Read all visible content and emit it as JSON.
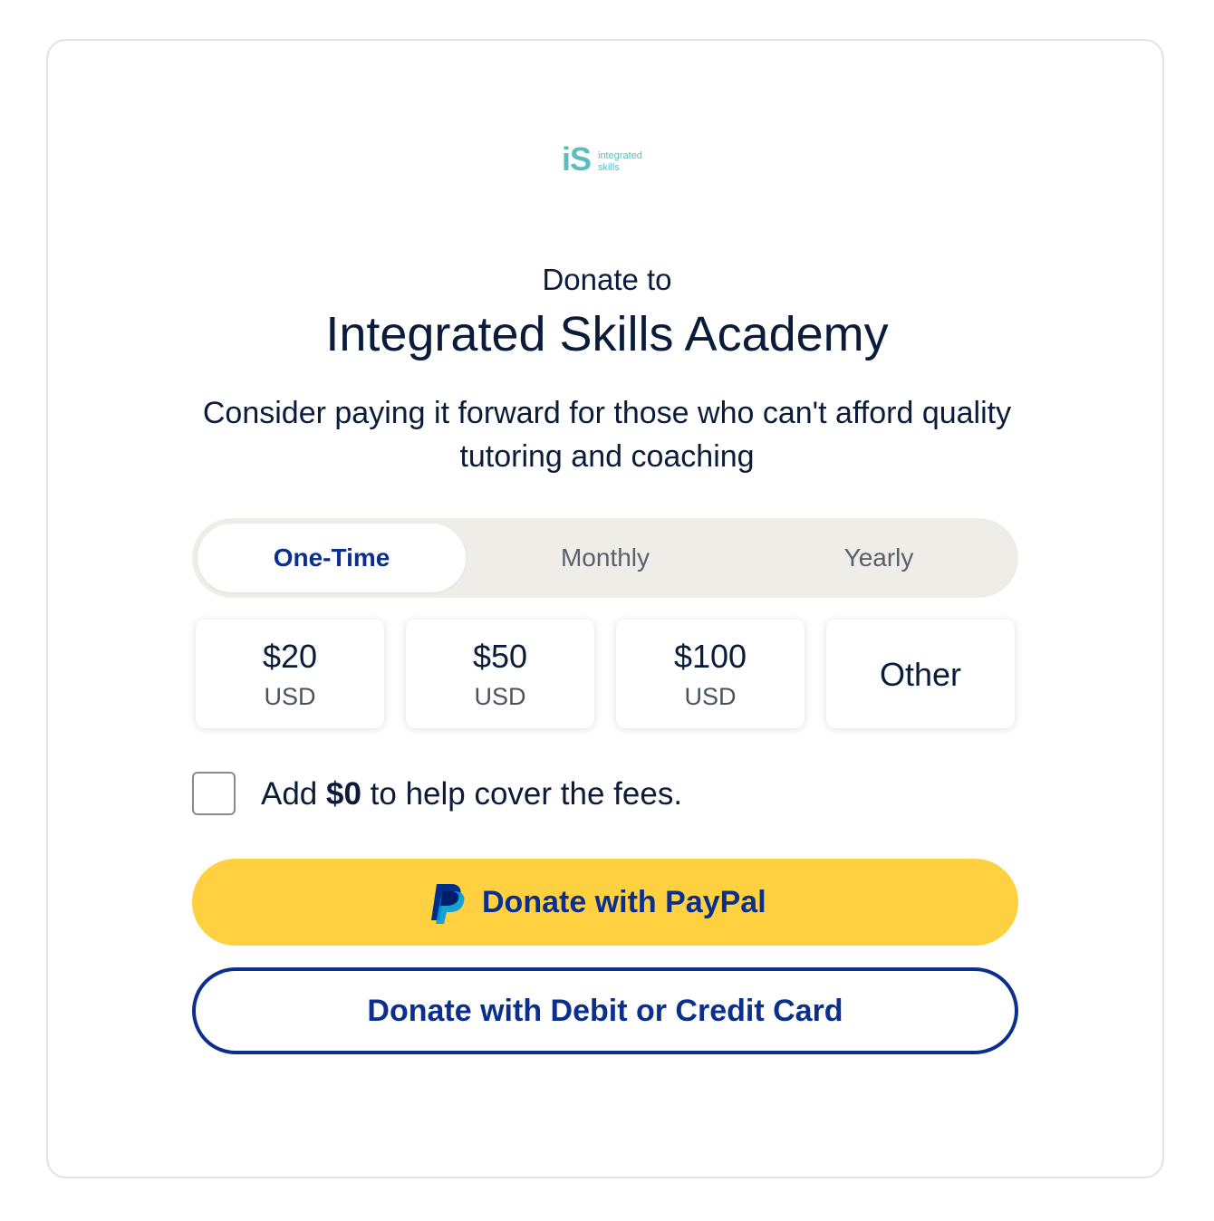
{
  "logo": {
    "mark": "iS",
    "line1": "integrated",
    "line2": "skills",
    "color": "#5bbdc0"
  },
  "header": {
    "donate_to": "Donate to",
    "organization": "Integrated Skills Academy",
    "subtitle": "Consider paying it forward for those who can't afford quality tutoring and coaching"
  },
  "frequency": {
    "selected": "One-Time",
    "tabs": [
      {
        "label": "One-Time"
      },
      {
        "label": "Monthly"
      },
      {
        "label": "Yearly"
      }
    ]
  },
  "amounts": [
    {
      "value": "$20",
      "currency": "USD"
    },
    {
      "value": "$50",
      "currency": "USD"
    },
    {
      "value": "$100",
      "currency": "USD"
    },
    {
      "value": "Other"
    }
  ],
  "fees": {
    "prefix": "Add ",
    "amount": "$0",
    "suffix": " to help cover the fees.",
    "checked": false
  },
  "buttons": {
    "paypal": {
      "label": "Donate with PayPal",
      "icon": "paypal-icon",
      "color": "#ffd140"
    },
    "card": {
      "label": "Donate with Debit or Credit Card",
      "color": "#0b2f8c"
    }
  }
}
